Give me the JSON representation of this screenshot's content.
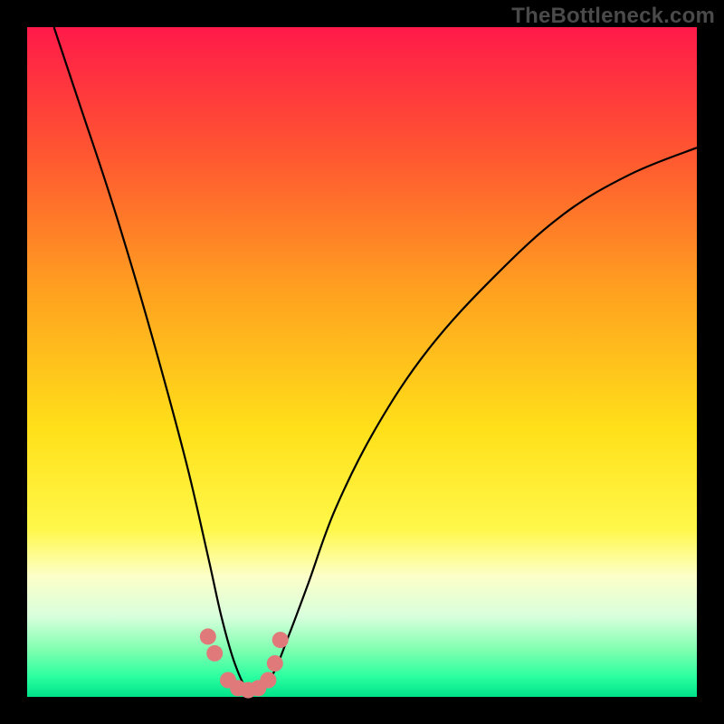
{
  "watermark": "TheBottleneck.com",
  "gradient": {
    "stops": [
      {
        "pos": 0.0,
        "color": "#ff1a49"
      },
      {
        "pos": 0.2,
        "color": "#ff5a30"
      },
      {
        "pos": 0.4,
        "color": "#ffa31f"
      },
      {
        "pos": 0.6,
        "color": "#ffe019"
      },
      {
        "pos": 0.75,
        "color": "#fff84a"
      },
      {
        "pos": 0.82,
        "color": "#fcffc9"
      },
      {
        "pos": 0.88,
        "color": "#d8ffdc"
      },
      {
        "pos": 0.93,
        "color": "#7fffb0"
      },
      {
        "pos": 0.97,
        "color": "#2bffa0"
      },
      {
        "pos": 1.0,
        "color": "#00e28a"
      }
    ]
  },
  "marker": {
    "color": "#e07a7a",
    "radius": 9
  },
  "chart_data": {
    "type": "line",
    "title": "",
    "xlabel": "",
    "ylabel": "",
    "xlim": [
      0,
      100
    ],
    "ylim": [
      0,
      100
    ],
    "note": "x is horizontal position (% of plot width from left), y is bottleneck/mismatch percentage (0 = optimal, at bottom; 100 = top). Curve reaches its minimum (~y=0) near x≈33.",
    "series": [
      {
        "name": "bottleneck-curve",
        "x": [
          4,
          8,
          12,
          16,
          20,
          24,
          27,
          29,
          31,
          33,
          35,
          37,
          39,
          42,
          46,
          52,
          60,
          70,
          80,
          90,
          100
        ],
        "y": [
          100,
          88,
          76,
          63,
          49,
          34,
          21,
          12,
          5,
          1,
          1,
          4,
          9,
          17,
          28,
          40,
          52,
          63,
          72,
          78,
          82
        ]
      }
    ],
    "markers": {
      "name": "highlight-points",
      "x": [
        27.0,
        28.0,
        30.0,
        31.5,
        33.0,
        34.5,
        36.0,
        37.0,
        37.8
      ],
      "y": [
        9.0,
        6.5,
        2.5,
        1.3,
        1.0,
        1.3,
        2.5,
        5.0,
        8.5
      ]
    }
  }
}
